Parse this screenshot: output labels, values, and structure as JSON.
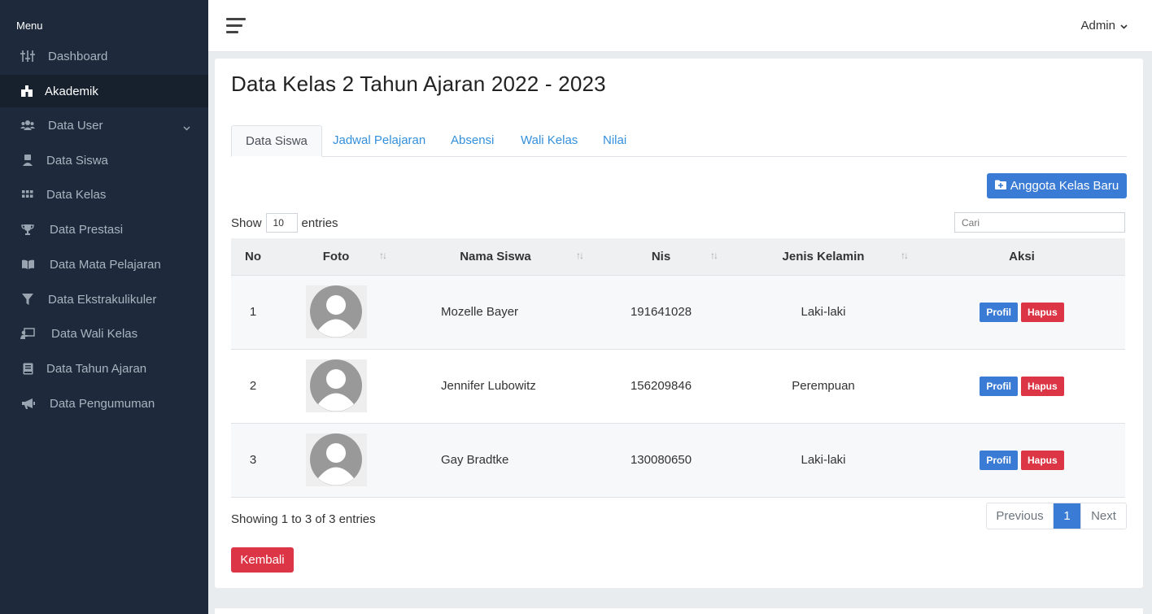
{
  "sidebar": {
    "menu_title": "Menu",
    "items": [
      {
        "label": "Dashboard",
        "icon": "sliders-icon"
      },
      {
        "label": "Akademik",
        "icon": "school-icon"
      },
      {
        "label": "Data User",
        "icon": "users-icon"
      },
      {
        "label": "Data Siswa",
        "icon": "student-icon"
      },
      {
        "label": "Data Kelas",
        "icon": "grid-icon"
      },
      {
        "label": "Data Prestasi",
        "icon": "trophy-icon"
      },
      {
        "label": "Data Mata Pelajaran",
        "icon": "book-open-icon"
      },
      {
        "label": "Data Ekstrakulikuler",
        "icon": "filter-icon"
      },
      {
        "label": "Data Wali Kelas",
        "icon": "chalkboard-teacher-icon"
      },
      {
        "label": "Data Tahun Ajaran",
        "icon": "book-icon"
      },
      {
        "label": "Data Pengumuman",
        "icon": "bullhorn-icon"
      }
    ]
  },
  "topbar": {
    "user": "Admin"
  },
  "page": {
    "title": "Data Kelas 2 Tahun Ajaran 2022 - 2023",
    "tabs": [
      "Data Siswa",
      "Jadwal Pelajaran",
      "Absensi",
      "Wali Kelas",
      "Nilai"
    ],
    "add_button": "Anggota Kelas Baru",
    "show_label": "Show",
    "show_value": "10",
    "entries_label": "entries",
    "search_placeholder": "Cari"
  },
  "table": {
    "headers": [
      "No",
      "Foto",
      "Nama Siswa",
      "Nis",
      "Jenis Kelamin",
      "Aksi"
    ],
    "rows": [
      {
        "no": "1",
        "nama": "Mozelle Bayer",
        "nis": "191641028",
        "jk": "Laki-laki"
      },
      {
        "no": "2",
        "nama": "Jennifer Lubowitz",
        "nis": "156209846",
        "jk": "Perempuan"
      },
      {
        "no": "3",
        "nama": "Gay Bradtke",
        "nis": "130080650",
        "jk": "Laki-laki"
      }
    ],
    "profil_label": "Profil",
    "hapus_label": "Hapus"
  },
  "footer": {
    "showing": "Showing 1 to 3 of 3 entries",
    "previous": "Previous",
    "page": "1",
    "next": "Next",
    "back_button": "Kembali"
  }
}
